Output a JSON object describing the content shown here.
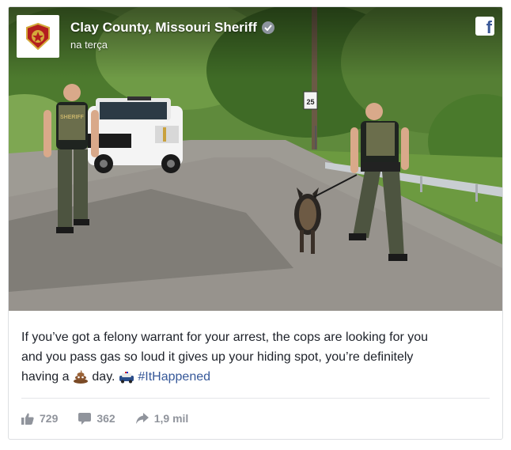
{
  "post": {
    "page_name": "Clay County, Missouri Sheriff",
    "timestamp": "na terça",
    "speed_sign": "25",
    "patch_text": "SHERIFF",
    "vest_text": "SHERIFF",
    "caption_line1": "If you’ve got a felony warrant for your arrest, the cops are looking for you",
    "caption_line2": "and you pass gas so loud it gives up your hiding spot, you’re definitely",
    "caption_pre": "having a",
    "caption_mid": "day.",
    "hashtag": "#ItHappened"
  },
  "stats": {
    "likes": "729",
    "comments": "362",
    "shares": "1,9 mil"
  },
  "icons": {
    "facebook": "facebook-logo-icon",
    "verified": "verified-check-icon",
    "like": "thumbs-up-icon",
    "comment": "speech-bubble-icon",
    "share": "share-arrow-icon",
    "poop": "poop-emoji",
    "police_car": "police-car-emoji"
  },
  "colors": {
    "hashtag": "#365899",
    "stats_text": "#90949c",
    "facebook_blue": "#3b5998"
  }
}
